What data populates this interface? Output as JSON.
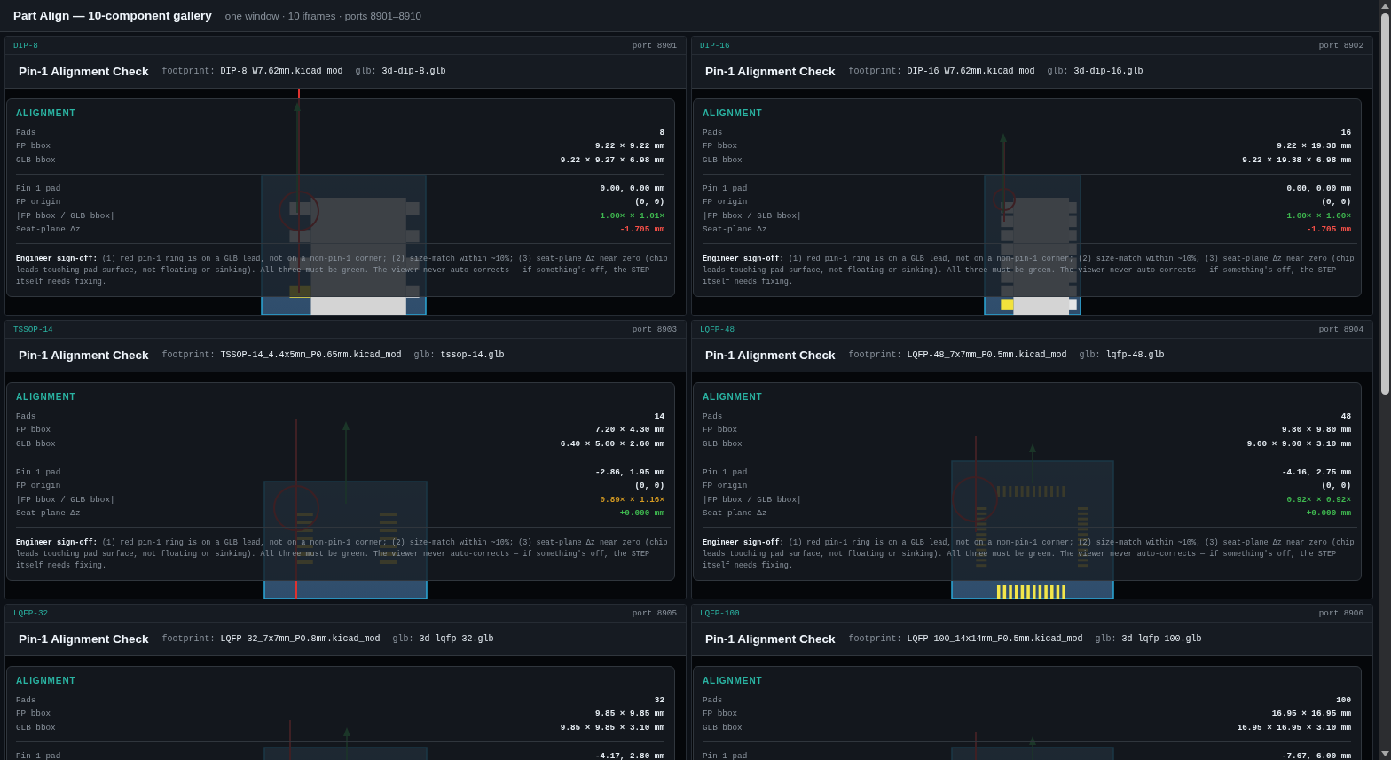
{
  "header": {
    "title": "Part Align — 10-component gallery",
    "subtitle": "one window · 10 iframes · ports 8901–8910"
  },
  "panels": [
    {
      "package": "DIP-8",
      "port": "port 8901",
      "title": "Pin-1 Alignment Check",
      "footprint_label": "footprint:",
      "footprint": "DIP-8_W7.62mm.kicad_mod",
      "glb_label": "glb:",
      "glb": "3d-dip-8.glb",
      "heading": "ALIGNMENT",
      "sections": [
        {
          "rows": [
            {
              "label": "Pads",
              "value": "8"
            },
            {
              "label": "FP bbox",
              "value": "9.22 × 9.22 mm"
            },
            {
              "label": "GLB bbox",
              "value": "9.22 × 9.27 × 6.98 mm"
            }
          ]
        },
        {
          "rows": [
            {
              "label": "Pin 1 pad",
              "value": "0.00, 0.00 mm"
            },
            {
              "label": "FP origin",
              "value": "(0, 0)"
            },
            {
              "label": "|FP bbox / GLB bbox|",
              "value": "1.00× × 1.01×",
              "color": "#3fb950"
            },
            {
              "label": "Seat-plane Δz",
              "value": "-1.705 mm",
              "color": "#f85149"
            }
          ]
        }
      ],
      "note": "**Engineer sign-off:** (1) red pin-1 ring is on a GLB lead, not on a non-pin-1 corner; (2) size-match within ~10%; (3) seat-plane Δz near zero (chip leads touching pad surface, not floating or sinking). All three must be green. The viewer never auto-corrects — if something's off, the STEP itself needs fixing."
    },
    {
      "package": "DIP-16",
      "port": "port 8902",
      "title": "Pin-1 Alignment Check",
      "footprint_label": "footprint:",
      "footprint": "DIP-16_W7.62mm.kicad_mod",
      "glb_label": "glb:",
      "glb": "3d-dip-16.glb",
      "heading": "ALIGNMENT",
      "sections": [
        {
          "rows": [
            {
              "label": "Pads",
              "value": "16"
            },
            {
              "label": "FP bbox",
              "value": "9.22 × 19.38 mm"
            },
            {
              "label": "GLB bbox",
              "value": "9.22 × 19.38 × 6.98 mm"
            }
          ]
        },
        {
          "rows": [
            {
              "label": "Pin 1 pad",
              "value": "0.00, 0.00 mm"
            },
            {
              "label": "FP origin",
              "value": "(0, 0)"
            },
            {
              "label": "|FP bbox / GLB bbox|",
              "value": "1.00× × 1.00×",
              "color": "#3fb950"
            },
            {
              "label": "Seat-plane Δz",
              "value": "-1.705 mm",
              "color": "#f85149"
            }
          ]
        }
      ],
      "note": "**Engineer sign-off:** (1) red pin-1 ring is on a GLB lead, not on a non-pin-1 corner; (2) size-match within ~10%; (3) seat-plane Δz near zero (chip leads touching pad surface, not floating or sinking). All three must be green. The viewer never auto-corrects — if something's off, the STEP itself needs fixing."
    },
    {
      "package": "TSSOP-14",
      "port": "port 8903",
      "title": "Pin-1 Alignment Check",
      "footprint_label": "footprint:",
      "footprint": "TSSOP-14_4.4x5mm_P0.65mm.kicad_mod",
      "glb_label": "glb:",
      "glb": "tssop-14.glb",
      "heading": "ALIGNMENT",
      "sections": [
        {
          "rows": [
            {
              "label": "Pads",
              "value": "14"
            },
            {
              "label": "FP bbox",
              "value": "7.20 × 4.30 mm"
            },
            {
              "label": "GLB bbox",
              "value": "6.40 × 5.00 × 2.60 mm"
            }
          ]
        },
        {
          "rows": [
            {
              "label": "Pin 1 pad",
              "value": "-2.86, 1.95 mm"
            },
            {
              "label": "FP origin",
              "value": "(0, 0)"
            },
            {
              "label": "|FP bbox / GLB bbox|",
              "value": "0.89× × 1.16×",
              "color": "#d29922"
            },
            {
              "label": "Seat-plane Δz",
              "value": "+0.000 mm",
              "color": "#3fb950"
            }
          ]
        }
      ],
      "note": "**Engineer sign-off:** (1) red pin-1 ring is on a GLB lead, not on a non-pin-1 corner; (2) size-match within ~10%; (3) seat-plane Δz near zero (chip leads touching pad surface, not floating or sinking). All three must be green. The viewer never auto-corrects — if something's off, the STEP itself needs fixing."
    },
    {
      "package": "LQFP-48",
      "port": "port 8904",
      "title": "Pin-1 Alignment Check",
      "footprint_label": "footprint:",
      "footprint": "LQFP-48_7x7mm_P0.5mm.kicad_mod",
      "glb_label": "glb:",
      "glb": "lqfp-48.glb",
      "heading": "ALIGNMENT",
      "sections": [
        {
          "rows": [
            {
              "label": "Pads",
              "value": "48"
            },
            {
              "label": "FP bbox",
              "value": "9.80 × 9.80 mm"
            },
            {
              "label": "GLB bbox",
              "value": "9.00 × 9.00 × 3.10 mm"
            }
          ]
        },
        {
          "rows": [
            {
              "label": "Pin 1 pad",
              "value": "-4.16, 2.75 mm"
            },
            {
              "label": "FP origin",
              "value": "(0, 0)"
            },
            {
              "label": "|FP bbox / GLB bbox|",
              "value": "0.92× × 0.92×",
              "color": "#3fb950"
            },
            {
              "label": "Seat-plane Δz",
              "value": "+0.000 mm",
              "color": "#3fb950"
            }
          ]
        }
      ],
      "note": "**Engineer sign-off:** (1) red pin-1 ring is on a GLB lead, not on a non-pin-1 corner; (2) size-match within ~10%; (3) seat-plane Δz near zero (chip leads touching pad surface, not floating or sinking). All three must be green. The viewer never auto-corrects — if something's off, the STEP itself needs fixing."
    },
    {
      "package": "LQFP-32",
      "port": "port 8905",
      "title": "Pin-1 Alignment Check",
      "footprint_label": "footprint:",
      "footprint": "LQFP-32_7x7mm_P0.8mm.kicad_mod",
      "glb_label": "glb:",
      "glb": "3d-lqfp-32.glb",
      "heading": "ALIGNMENT",
      "sections": [
        {
          "rows": [
            {
              "label": "Pads",
              "value": "32"
            },
            {
              "label": "FP bbox",
              "value": "9.85 × 9.85 mm"
            },
            {
              "label": "GLB bbox",
              "value": "9.85 × 9.85 × 3.10 mm"
            }
          ]
        },
        {
          "rows": [
            {
              "label": "Pin 1 pad",
              "value": "-4.17, 2.80 mm"
            }
          ]
        }
      ]
    },
    {
      "package": "LQFP-100",
      "port": "port 8906",
      "title": "Pin-1 Alignment Check",
      "footprint_label": "footprint:",
      "footprint": "LQFP-100_14x14mm_P0.5mm.kicad_mod",
      "glb_label": "glb:",
      "glb": "3d-lqfp-100.glb",
      "heading": "ALIGNMENT",
      "sections": [
        {
          "rows": [
            {
              "label": "Pads",
              "value": "100"
            },
            {
              "label": "FP bbox",
              "value": "16.95 × 16.95 mm"
            },
            {
              "label": "GLB bbox",
              "value": "16.95 × 16.95 × 3.10 mm"
            }
          ]
        },
        {
          "rows": [
            {
              "label": "Pin 1 pad",
              "value": "-7.67, 6.00 mm"
            }
          ]
        }
      ]
    }
  ]
}
